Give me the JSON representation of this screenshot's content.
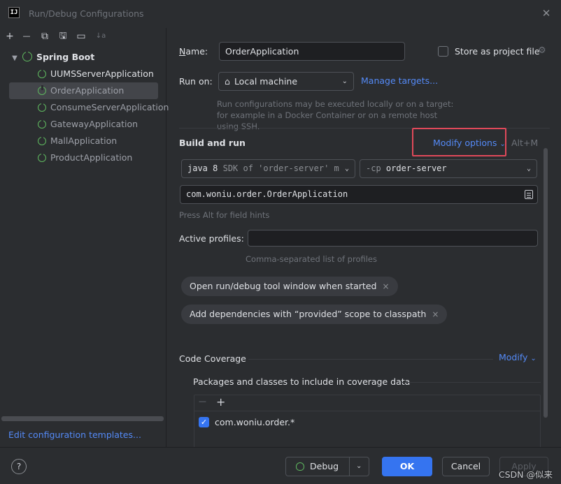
{
  "window": {
    "icon_text": "IJ",
    "title": "Run/Debug Configurations",
    "close_glyph": "✕"
  },
  "toolbar": {
    "add": "+",
    "remove": "—",
    "copy": "⧉",
    "save": "🖫",
    "folder": "▭",
    "sort": "↓a"
  },
  "tree": {
    "group_label": "Spring Boot",
    "items": [
      {
        "label": "UUMSServerApplication",
        "state": "normal"
      },
      {
        "label": "OrderApplication",
        "state": "selected"
      },
      {
        "label": "ConsumeServerApplication",
        "state": "dim"
      },
      {
        "label": "GatewayApplication",
        "state": "dim"
      },
      {
        "label": "MallApplication",
        "state": "dim"
      },
      {
        "label": "ProductApplication",
        "state": "dim"
      }
    ]
  },
  "edit_templates_link": "Edit configuration templates...",
  "form": {
    "name_label_prefix": "N",
    "name_label_rest": "ame:",
    "name_value": "OrderApplication",
    "store_as_project_file": "Store as project file",
    "run_on_label": "Run on:",
    "run_on_value": "Local machine",
    "manage_targets": "Manage targets...",
    "run_on_hint": "Run configurations may be executed locally or on a target: for example in a Docker Container or on a remote host using SSH.",
    "build_and_run": "Build and run",
    "modify_options": "Modify options",
    "modify_shortcut": "Alt+M",
    "jdk_java": "java 8",
    "jdk_rest": "SDK of 'order-server' m",
    "cp_flag": "-cp",
    "cp_value": "order-server",
    "main_class": "com.woniu.order.OrderApplication",
    "field_hint": "Press Alt for field hints",
    "active_profiles_label": "Active profiles:",
    "active_profiles_value": "",
    "profiles_hint": "Comma-separated list of profiles",
    "chips": [
      "Open run/debug tool window when started",
      "Add dependencies with “provided” scope to classpath"
    ],
    "chip_remove": "×",
    "code_coverage": "Code Coverage",
    "coverage_modify": "Modify",
    "coverage_packages_label": "Packages and classes to include in coverage data",
    "coverage_remove": "—",
    "coverage_add": "+",
    "coverage_entries": [
      {
        "pattern": "com.woniu.order.*",
        "checked": true
      }
    ]
  },
  "footer": {
    "help": "?",
    "debug": "Debug",
    "ok": "OK",
    "cancel": "Cancel",
    "apply": "Apply",
    "watermark": "CSDN @似来"
  },
  "colors": {
    "background": "#2b2d30",
    "accent": "#3574f0",
    "link": "#548af7",
    "highlight": "#e0495a",
    "spring_green": "#5fb85f"
  }
}
